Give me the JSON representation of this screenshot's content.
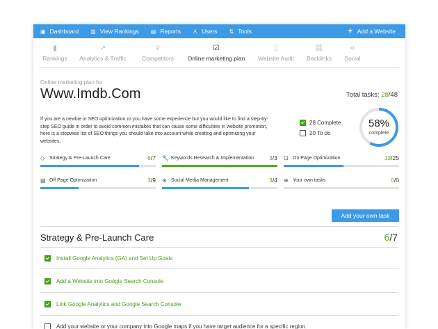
{
  "topnav": {
    "items": [
      {
        "icon": "▣",
        "label": "Dashboard"
      },
      {
        "icon": "▥",
        "label": "View Rankings"
      },
      {
        "icon": "▤",
        "label": "Reports"
      },
      {
        "icon": "♙",
        "label": "Users"
      },
      {
        "icon": "⇅",
        "label": "Tools"
      }
    ],
    "add_label": "Add a Website",
    "add_icon": "+"
  },
  "tabs": [
    {
      "icon": "▮",
      "label": "Rankings"
    },
    {
      "icon": "↗",
      "label": "Analytics & Traffic"
    },
    {
      "icon": "♕",
      "label": "Competitors"
    },
    {
      "icon": "☑",
      "label": "Online marketing plan"
    },
    {
      "icon": "▯",
      "label": "Website Audit"
    },
    {
      "icon": "⛓",
      "label": "Backlinks"
    },
    {
      "icon": "⋖",
      "label": "Social"
    }
  ],
  "plan": {
    "subtitle": "Online marketing plan for",
    "site": "Www.Imdb.Com",
    "total_label": "Total tasks: ",
    "total_done": "28",
    "total_all": "/48",
    "description": "If you are a newbie in SEO optimization or you have some experience but you would like to find a step-by-step SEO guide in order to avoid common mistakes that can cause some difficulties in website promotion, here is a stepwise list of SEO things you should take into account while creating and optimizing your websites.",
    "complete_label": "28 Complete",
    "todo_label": "20 To do",
    "percent": "58%",
    "percent_label": "complete",
    "progress_fraction": 0.58
  },
  "categories": [
    {
      "icon": "◇",
      "label": "Strategy & Pre-Launch Care",
      "done": "6",
      "total": "/7",
      "fraction": 0.857,
      "color": "blue"
    },
    {
      "icon": "🔧",
      "label": "Keywords Research & Implementation",
      "done": "3",
      "total": "/3",
      "fraction": 1.0,
      "color": "green"
    },
    {
      "icon": "⊡",
      "label": "On Page Optimization",
      "done": "13",
      "total": "/25",
      "fraction": 0.52,
      "color": "blue"
    },
    {
      "icon": "▤",
      "label": "Off Page Optimization",
      "done": "3",
      "total": "/9",
      "fraction": 0.333,
      "color": "blue"
    },
    {
      "icon": "⊛",
      "label": "Social Media Management",
      "done": "3",
      "total": "/4",
      "fraction": 0.75,
      "color": "blue"
    },
    {
      "icon": "⊕",
      "label": "Your own tasks",
      "done": "0",
      "total": "/0",
      "fraction": 0.0,
      "color": "blue"
    }
  ],
  "add_task_label": "Add your own task",
  "section": {
    "title": "Strategy & Pre-Launch Care",
    "done": "6",
    "total": "/7"
  },
  "tasks": [
    {
      "label": "Install Google Analytics (GA) and Set Up Goals",
      "done": true
    },
    {
      "label": "Add a Website into Google Search Console",
      "done": true
    },
    {
      "label": "Link Google Analytics and Google Search Console",
      "done": true
    },
    {
      "label": "Add your website or your company into Google maps if you have target audience for a specific region.",
      "done": false
    }
  ],
  "colors": {
    "accent": "#3d9ae6",
    "success": "#5aaa1e"
  }
}
